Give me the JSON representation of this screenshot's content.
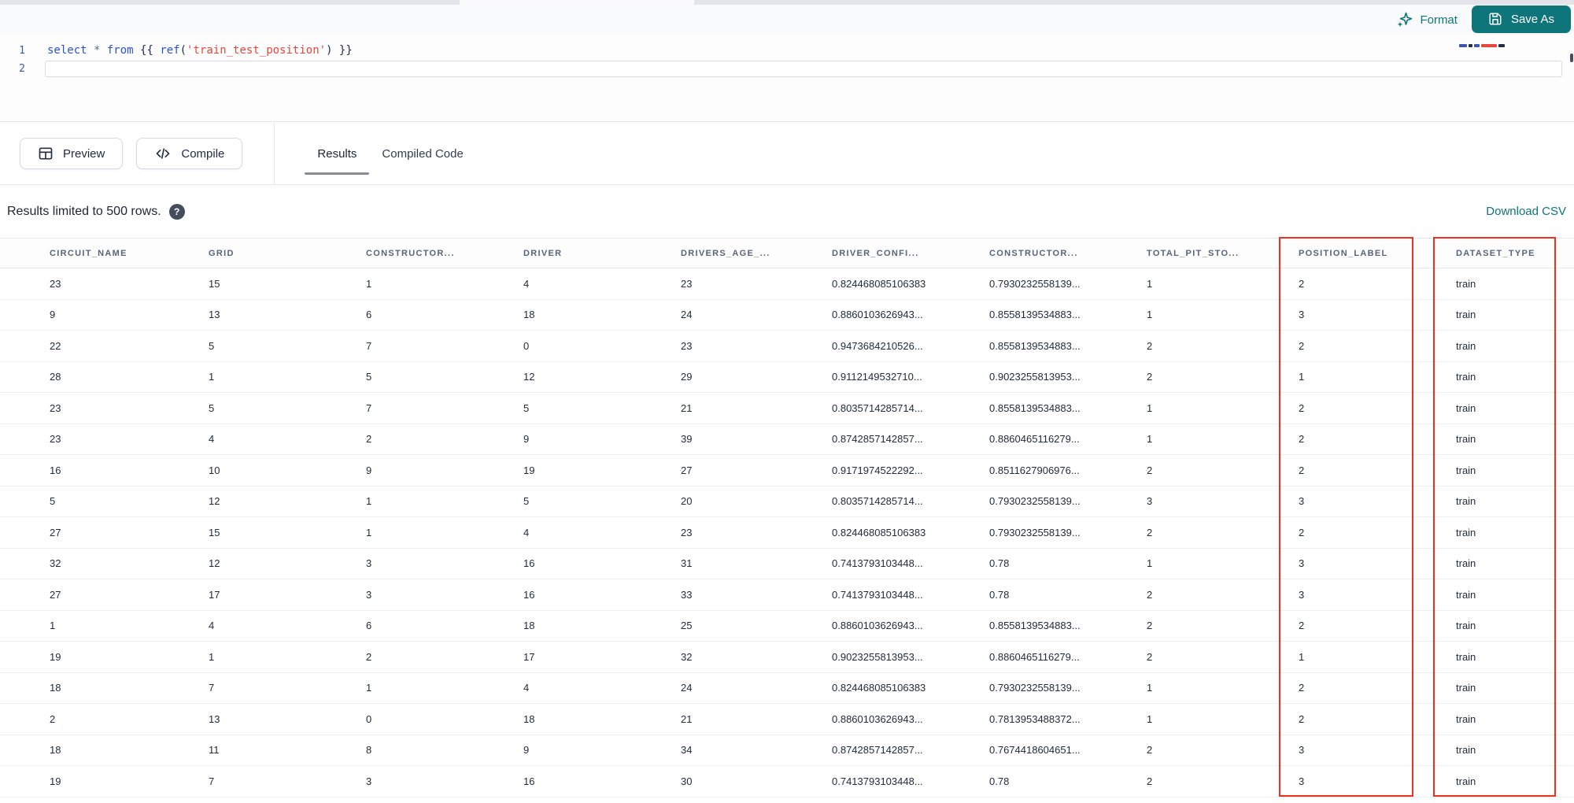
{
  "colors": {
    "accent_teal": "#0e757b",
    "annotation_red": "#ef3124",
    "keyword_blue": "#2b50d8",
    "string_red": "#e8453c",
    "punct_navy": "#222e4e",
    "operator_gray": "#5b6b8c",
    "line_number_blue": "#3d54b4",
    "tab_underline_gray": "#878d96"
  },
  "editor": {
    "line_numbers": [
      "1",
      "2"
    ],
    "code_tokens": [
      {
        "type": "keyword",
        "text": "select"
      },
      {
        "type": "operator",
        "text": " * "
      },
      {
        "type": "keyword",
        "text": "from"
      },
      {
        "type": "punct",
        "text": " {{ "
      },
      {
        "type": "function",
        "text": "ref"
      },
      {
        "type": "punct",
        "text": "("
      },
      {
        "type": "string",
        "text": "'train_test_position'"
      },
      {
        "type": "punct",
        "text": ")"
      },
      {
        "type": "punct",
        "text": " }}"
      }
    ],
    "minimap_segments": [
      {
        "color": "#3d54b4",
        "width": 10
      },
      {
        "color": "#222e4e",
        "width": 5
      },
      {
        "color": "#3d54b4",
        "width": 7
      },
      {
        "color": "#e8453c",
        "width": 20
      },
      {
        "color": "#222e4e",
        "width": 8
      }
    ],
    "toolbar": {
      "format_label": "Format",
      "save_as_label": "Save As"
    }
  },
  "results_panel": {
    "preview_label": "Preview",
    "compile_label": "Compile",
    "tabs": [
      {
        "label": "Results",
        "active": true
      },
      {
        "label": "Compiled Code",
        "active": false
      }
    ],
    "status_text": "Results limited to 500 rows.",
    "download_csv_label": "Download CSV"
  },
  "table": {
    "columns": [
      "CIRCUIT_NAME",
      "GRID",
      "CONSTRUCTOR...",
      "DRIVER",
      "DRIVERS_AGE_...",
      "DRIVER_CONFI...",
      "CONSTRUCTOR...",
      "TOTAL_PIT_STO...",
      "POSITION_LABEL",
      "DATASET_TYPE"
    ],
    "highlighted_columns": [
      "POSITION_LABEL",
      "DATASET_TYPE"
    ],
    "rows": [
      [
        "23",
        "15",
        "1",
        "4",
        "23",
        "0.824468085106383",
        "0.7930232558139...",
        "1",
        "2",
        "train"
      ],
      [
        "9",
        "13",
        "6",
        "18",
        "24",
        "0.8860103626943...",
        "0.8558139534883...",
        "1",
        "3",
        "train"
      ],
      [
        "22",
        "5",
        "7",
        "0",
        "23",
        "0.9473684210526...",
        "0.8558139534883...",
        "2",
        "2",
        "train"
      ],
      [
        "28",
        "1",
        "5",
        "12",
        "29",
        "0.9112149532710...",
        "0.9023255813953...",
        "2",
        "1",
        "train"
      ],
      [
        "23",
        "5",
        "7",
        "5",
        "21",
        "0.8035714285714...",
        "0.8558139534883...",
        "1",
        "2",
        "train"
      ],
      [
        "23",
        "4",
        "2",
        "9",
        "39",
        "0.8742857142857...",
        "0.8860465116279...",
        "1",
        "2",
        "train"
      ],
      [
        "16",
        "10",
        "9",
        "19",
        "27",
        "0.9171974522292...",
        "0.8511627906976...",
        "2",
        "2",
        "train"
      ],
      [
        "5",
        "12",
        "1",
        "5",
        "20",
        "0.8035714285714...",
        "0.7930232558139...",
        "3",
        "3",
        "train"
      ],
      [
        "27",
        "15",
        "1",
        "4",
        "23",
        "0.824468085106383",
        "0.7930232558139...",
        "2",
        "2",
        "train"
      ],
      [
        "32",
        "12",
        "3",
        "16",
        "31",
        "0.7413793103448...",
        "0.78",
        "1",
        "3",
        "train"
      ],
      [
        "27",
        "17",
        "3",
        "16",
        "33",
        "0.7413793103448...",
        "0.78",
        "2",
        "3",
        "train"
      ],
      [
        "1",
        "4",
        "6",
        "18",
        "25",
        "0.8860103626943...",
        "0.8558139534883...",
        "2",
        "2",
        "train"
      ],
      [
        "19",
        "1",
        "2",
        "17",
        "32",
        "0.9023255813953...",
        "0.8860465116279...",
        "2",
        "1",
        "train"
      ],
      [
        "18",
        "7",
        "1",
        "4",
        "24",
        "0.824468085106383",
        "0.7930232558139...",
        "1",
        "2",
        "train"
      ],
      [
        "2",
        "13",
        "0",
        "18",
        "21",
        "0.8860103626943...",
        "0.7813953488372...",
        "1",
        "2",
        "train"
      ],
      [
        "18",
        "11",
        "8",
        "9",
        "34",
        "0.8742857142857...",
        "0.7674418604651...",
        "2",
        "3",
        "train"
      ],
      [
        "19",
        "7",
        "3",
        "16",
        "30",
        "0.7413793103448...",
        "0.78",
        "2",
        "3",
        "train"
      ]
    ]
  }
}
